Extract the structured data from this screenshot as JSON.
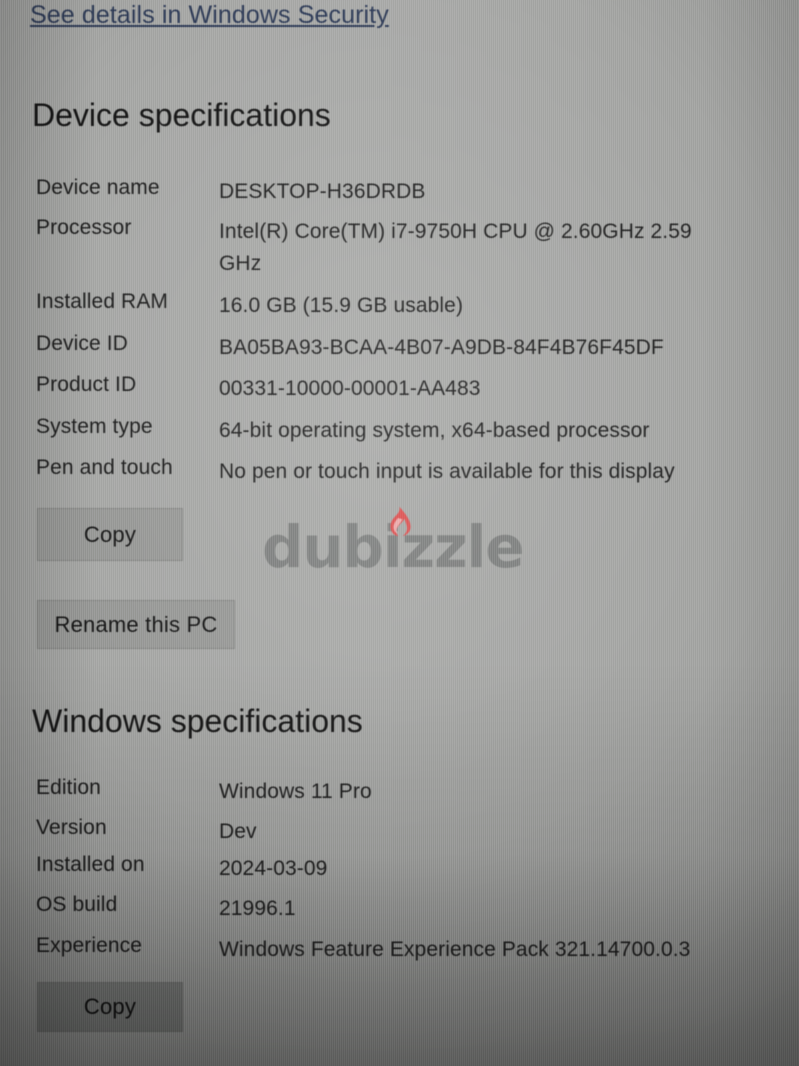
{
  "page": {
    "link_text": "See details in Windows Security",
    "link_color": "#2f3c58",
    "background_color": "#a9aaa8",
    "button_color": "#9a9b99"
  },
  "device_specifications": {
    "heading": "Device specifications",
    "rows": [
      {
        "label": "Device name",
        "value": "DESKTOP-H36DRDB"
      },
      {
        "label": "Processor",
        "value": "Intel(R) Core(TM) i7-9750H CPU @ 2.60GHz   2.59 GHz"
      },
      {
        "label": "Installed RAM",
        "value": "16.0 GB (15.9 GB usable)"
      },
      {
        "label": "Device ID",
        "value": "BA05BA93-BCAA-4B07-A9DB-84F4B76F45DF"
      },
      {
        "label": "Product ID",
        "value": "00331-10000-00001-AA483"
      },
      {
        "label": "System type",
        "value": "64-bit operating system, x64-based processor"
      },
      {
        "label": "Pen and touch",
        "value": "No pen or touch input is available for this display"
      }
    ],
    "copy_label": "Copy",
    "rename_label": "Rename this PC"
  },
  "windows_specifications": {
    "heading": "Windows specifications",
    "rows": [
      {
        "label": "Edition",
        "value": "Windows 11 Pro"
      },
      {
        "label": "Version",
        "value": "Dev"
      },
      {
        "label": "Installed on",
        "value": "2024-03-09"
      },
      {
        "label": "OS build",
        "value": "21996.1"
      },
      {
        "label": "Experience",
        "value": "Windows Feature Experience Pack 321.14700.0.3"
      }
    ],
    "copy_label": "Copy"
  },
  "watermark": {
    "text": "dubizzle",
    "text_color": "#7d7f7e",
    "flame_color": "#e24b4b",
    "flame_icon": "flame-icon"
  }
}
